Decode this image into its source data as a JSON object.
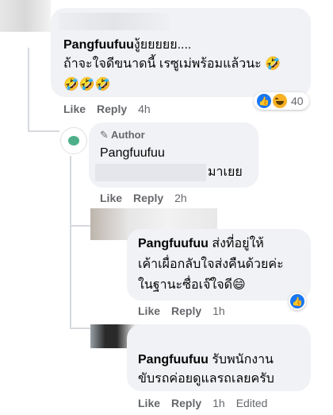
{
  "comments": [
    {
      "name": "Pangfuufuu",
      "text_line1": "งู้ยยยยย....",
      "text_line2": "ถ้าจะใจดีขนาดนี้ เรซูเม่พร้อมแล้วนะ 🤣",
      "text_line3": "🤣🤣🤣",
      "like": "Like",
      "reply": "Reply",
      "time": "4h",
      "reaction_count": "40"
    },
    {
      "author_badge": "Author",
      "name": "Pangfuufuu",
      "text_tail": "มาเยย",
      "like": "Like",
      "reply": "Reply",
      "time": "2h"
    },
    {
      "name": "Pangfuufuu",
      "text_line1": "ส่งที่อยู่ให้",
      "text_line2": "เค้าเผื่อกลับใจส่งคืนด้วยค่ะ",
      "text_line3": "ในฐานะซื่อเจ๊ใจดี😄",
      "like": "Like",
      "reply": "Reply",
      "time": "1h"
    },
    {
      "name": "Pangfuufuu",
      "text_line1": "รับพนักงาน",
      "text_line2": "ขับรถค่อยดูแลรถเลยครับ",
      "like": "Like",
      "reply": "Reply",
      "time": "1h",
      "edited": "Edited"
    }
  ]
}
